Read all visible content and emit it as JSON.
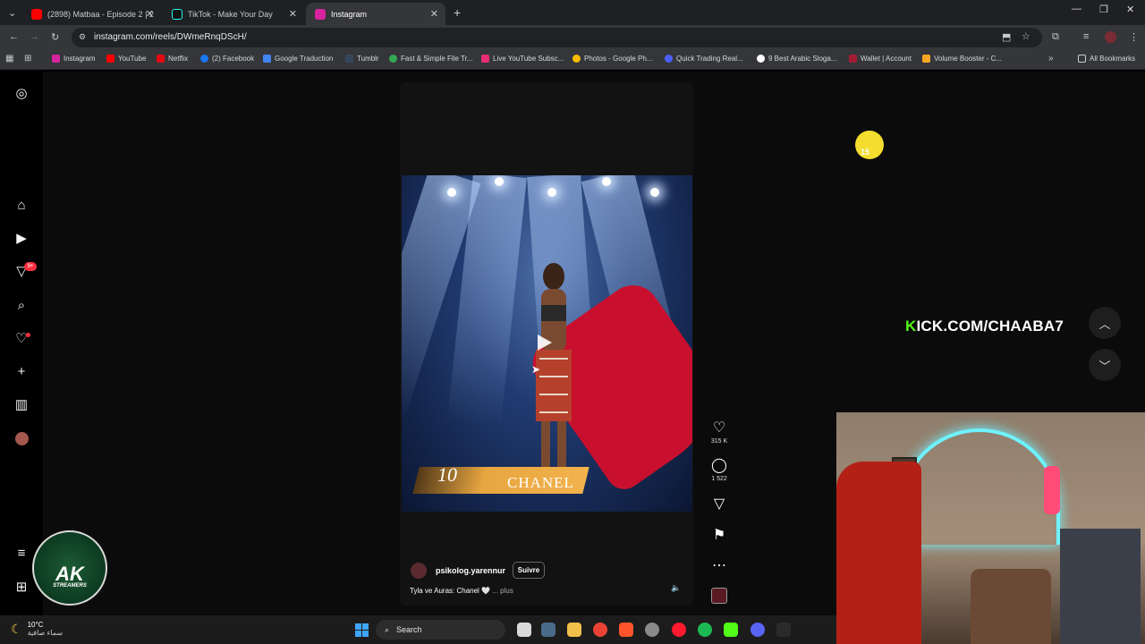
{
  "tabs": [
    {
      "title": "(2898) Matbaa - Episode 2 | 2",
      "color": "#ff0000"
    },
    {
      "title": "TikTok - Make Your Day",
      "color": "#111111"
    },
    {
      "title": "Instagram",
      "color": "#d6249f"
    }
  ],
  "new_tab": "+",
  "url": "instagram.com/reels/DWmeRnqDScH/",
  "bookmarks": [
    {
      "label": "Instagram",
      "color": "#d6249f"
    },
    {
      "label": "YouTube",
      "color": "#ff0000"
    },
    {
      "label": "Netflix",
      "color": "#e50914"
    },
    {
      "label": "(2) Facebook",
      "color": "#1877f2"
    },
    {
      "label": "Google Traduction",
      "color": "#4285f4"
    },
    {
      "label": "Tumblr",
      "color": "#36465d"
    },
    {
      "label": "Fast & Simple File Tr...",
      "color": "#34a853"
    },
    {
      "label": "Live YouTube Subsc...",
      "color": "#e62e74"
    },
    {
      "label": "Photos - Google Ph...",
      "color": "#fbbc04"
    },
    {
      "label": "Quick Trading Real...",
      "color": "#4a60ff"
    },
    {
      "label": "9 Best Arabic Sloga...",
      "color": "#ffffff"
    },
    {
      "label": "Wallet | Account",
      "color": "#a41d35"
    },
    {
      "label": "Volume Booster - C...",
      "color": "#f5a623"
    }
  ],
  "all_bookmarks": "All Bookmarks",
  "nav_badge": "9+",
  "reel": {
    "overlay_number": "10",
    "overlay_name": "CHANEL",
    "likes": "315 K",
    "comments": "1 522",
    "username": "psikolog.yarennur",
    "follow_label": "Suivre",
    "caption": "Tyla ve Auras: Chanel 🤍",
    "more": "... plus"
  },
  "stream": {
    "kick_letter": "K",
    "kick_rest": "ICK.COM/CHAABA7",
    "mascot_number": "15"
  },
  "logo": {
    "main": "AK",
    "sub": "STREAMERS"
  },
  "taskbar": {
    "temperature": "10°C",
    "weather_text": "سماء صافية",
    "search_label": "Search"
  }
}
